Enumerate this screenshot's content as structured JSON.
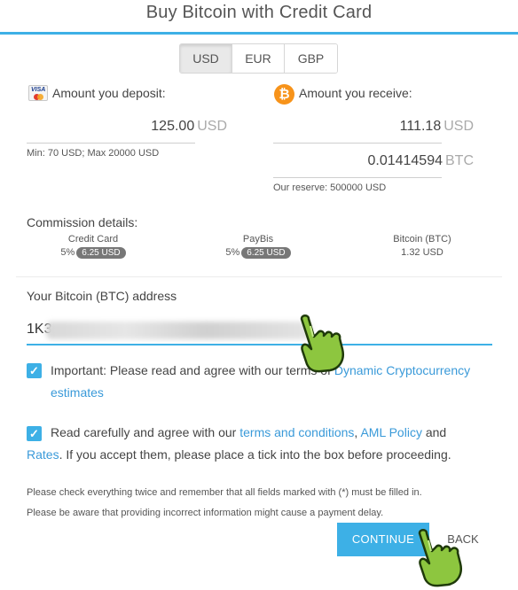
{
  "header": {
    "title": "Buy Bitcoin with Credit Card"
  },
  "currency_tabs": [
    "USD",
    "EUR",
    "GBP"
  ],
  "currency_selected": "USD",
  "deposit": {
    "label": "Amount you deposit:",
    "amount": "125.00",
    "unit": "USD",
    "limits": "Min: 70 USD; Max 20000 USD"
  },
  "receive": {
    "label": "Amount you receive:",
    "amount_usd": "111.18",
    "unit_usd": "USD",
    "amount_btc": "0.01414594",
    "unit_btc": "BTC",
    "reserve": "Our reserve: 500000 USD"
  },
  "commission": {
    "title": "Commission details:",
    "items": [
      {
        "name": "Credit Card",
        "percent": "5%",
        "amount": "6.25 USD"
      },
      {
        "name": "PayBis",
        "percent": "5%",
        "amount": "6.25 USD"
      },
      {
        "name": "Bitcoin (BTC)",
        "percent": "",
        "amount": "1.32 USD"
      }
    ]
  },
  "address": {
    "label": "Your Bitcoin (BTC) address",
    "value": "1K3"
  },
  "agreement1": {
    "text": "Important: Please read and agree with our terms of",
    "link": "Dynamic Cryptocurrency estimates"
  },
  "agreement2": {
    "prefix": "Read carefully and agree with our",
    "link_terms": "terms and conditions",
    "comma": ",",
    "link_aml": "AML Policy",
    "and": "and",
    "link_rates": "Rates",
    "suffix": ". If you accept them, please place a tick into the box before proceeding."
  },
  "notes": {
    "line1": "Please check everything twice and remember that all fields marked with (*) must be filled in.",
    "line2": "Please be aware that providing incorrect information might cause a payment delay."
  },
  "buttons": {
    "continue": "CONTINUE",
    "back": "BACK"
  },
  "colors": {
    "accent": "#3db0e6",
    "link": "#3a9ad9",
    "bitcoin": "#f7931a",
    "pointer": "#8dc63f"
  }
}
